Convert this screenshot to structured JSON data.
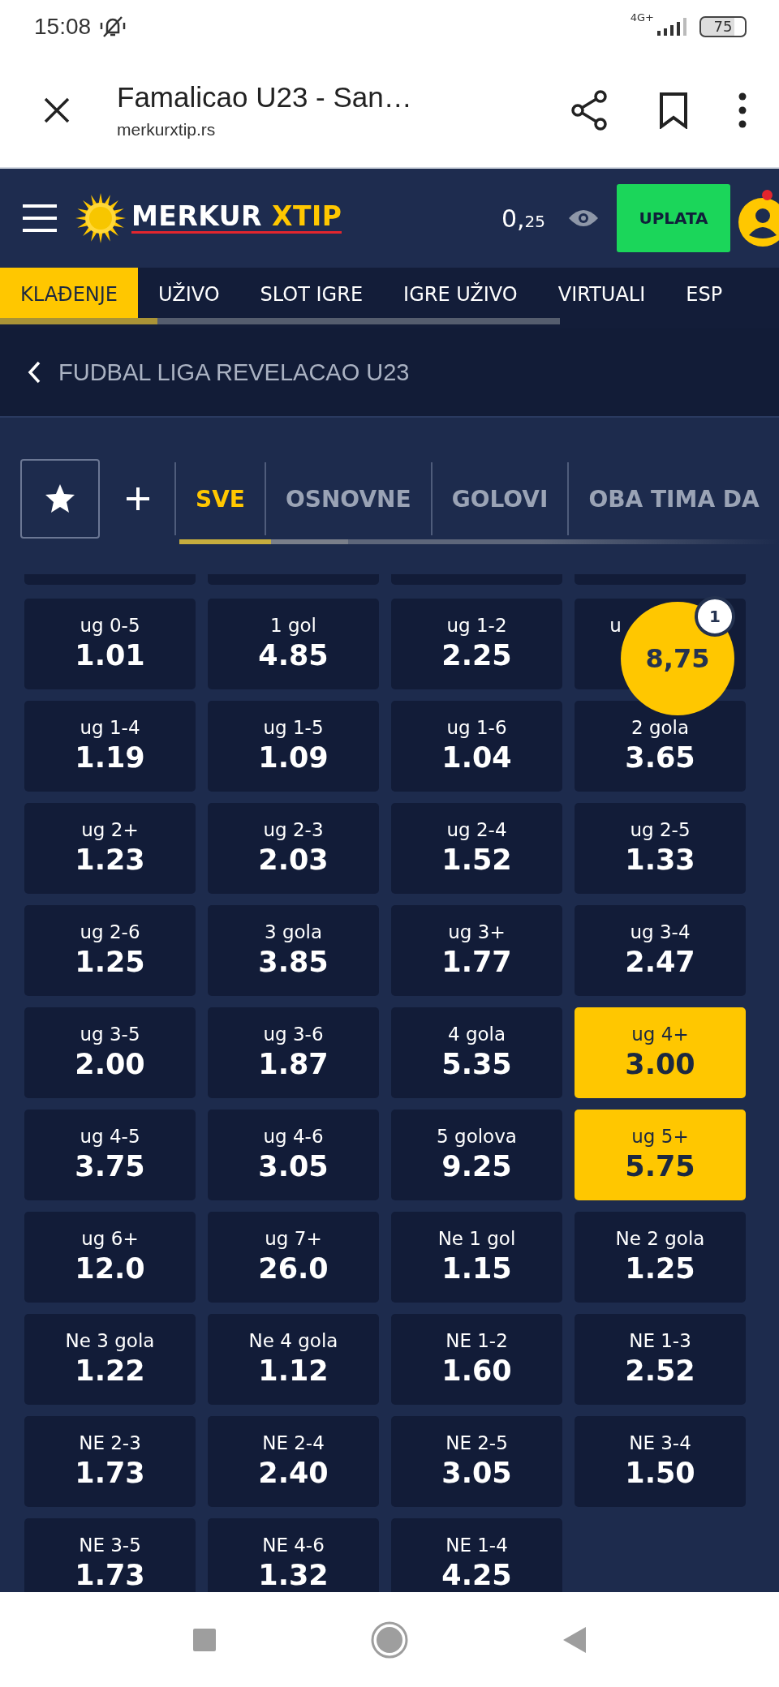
{
  "status_bar": {
    "time": "15:08",
    "network": "4G+",
    "battery": "75"
  },
  "browser": {
    "title": "Famalicao U23 - San…",
    "url": "merkurxtip.rs"
  },
  "header": {
    "logo_text": "MERKUR",
    "logo_accent": "XTIP",
    "balance": "0,$_{25}$",
    "deposit_button": "UPLATA",
    "notification": true
  },
  "nav_tabs": [
    {
      "label": "KLAĐENJE",
      "selected": true
    },
    {
      "label": "UŽIVO",
      "selected": false
    },
    {
      "label": "SLOT IGRE",
      "selected": false
    },
    {
      "label": "IGRE UŽIVO",
      "selected": false
    },
    {
      "label": "VIRTUALI",
      "selected": false
    },
    {
      "label": "ESP",
      "selected": false
    }
  ],
  "breadcrumb": "FUDBAL LIGA REVELACAO U23",
  "market_tabs": [
    {
      "label": "SVE",
      "selected": true
    },
    {
      "label": "OSNOVNE",
      "selected": false
    },
    {
      "label": "GOLOVI",
      "selected": false
    },
    {
      "label": "OBA TIMA DA",
      "selected": false
    }
  ],
  "odds": [
    {
      "label": "ug 0-5",
      "odds": "1.01",
      "selected": false
    },
    {
      "label": "1 gol",
      "odds": "4.85",
      "selected": false
    },
    {
      "label": "ug 1-2",
      "odds": "2.25",
      "selected": false
    },
    {
      "label": "u",
      "selected": false,
      "kind": "covered"
    },
    {
      "label": "ug 1-4",
      "odds": "1.19",
      "selected": false
    },
    {
      "label": "ug 1-5",
      "odds": "1.09",
      "selected": false
    },
    {
      "label": "ug 1-6",
      "odds": "1.04",
      "selected": false
    },
    {
      "label": "2 gola",
      "odds": "3.65",
      "selected": false
    },
    {
      "label": "ug 2+",
      "odds": "1.23",
      "selected": false
    },
    {
      "label": "ug 2-3",
      "odds": "2.03",
      "selected": false
    },
    {
      "label": "ug 2-4",
      "odds": "1.52",
      "selected": false
    },
    {
      "label": "ug 2-5",
      "odds": "1.33",
      "selected": false
    },
    {
      "label": "ug 2-6",
      "odds": "1.25",
      "selected": false
    },
    {
      "label": "3 gola",
      "odds": "3.85",
      "selected": false
    },
    {
      "label": "ug 3+",
      "odds": "1.77",
      "selected": false
    },
    {
      "label": "ug 3-4",
      "odds": "2.47",
      "selected": false
    },
    {
      "label": "ug 3-5",
      "odds": "2.00",
      "selected": false
    },
    {
      "label": "ug 3-6",
      "odds": "1.87",
      "selected": false
    },
    {
      "label": "4 gola",
      "odds": "5.35",
      "selected": false
    },
    {
      "label": "ug 4+",
      "odds": "3.00",
      "selected": true
    },
    {
      "label": "ug 4-5",
      "odds": "3.75",
      "selected": false
    },
    {
      "label": "ug 4-6",
      "odds": "3.05",
      "selected": false
    },
    {
      "label": "5 golova",
      "odds": "9.25",
      "selected": false
    },
    {
      "label": "ug 5+",
      "odds": "5.75",
      "selected": true
    },
    {
      "label": "ug 6+",
      "odds": "12.0",
      "selected": false
    },
    {
      "label": "ug 7+",
      "odds": "26.0",
      "selected": false
    },
    {
      "label": "Ne 1 gol",
      "odds": "1.15",
      "selected": false
    },
    {
      "label": "Ne 2 gola",
      "odds": "1.25",
      "selected": false
    },
    {
      "label": "Ne 3 gola",
      "odds": "1.22",
      "selected": false
    },
    {
      "label": "Ne 4 gola",
      "odds": "1.12",
      "selected": false
    },
    {
      "label": "NE 1-2",
      "odds": "1.60",
      "selected": false
    },
    {
      "label": "NE 1-3",
      "odds": "2.52",
      "selected": false
    },
    {
      "label": "NE 2-3",
      "odds": "1.73",
      "selected": false
    },
    {
      "label": "NE 2-4",
      "odds": "2.40",
      "selected": false
    },
    {
      "label": "NE 2-5",
      "odds": "3.05",
      "selected": false
    },
    {
      "label": "NE 3-4",
      "odds": "1.50",
      "selected": false
    },
    {
      "label": "NE 3-5",
      "odds": "1.73",
      "selected": false
    },
    {
      "label": "NE 4-6",
      "odds": "1.32",
      "selected": false
    },
    {
      "label": "NE 1-4",
      "odds": "4.25",
      "selected": false
    }
  ],
  "betslip": {
    "total": "8,75",
    "count": "1"
  }
}
